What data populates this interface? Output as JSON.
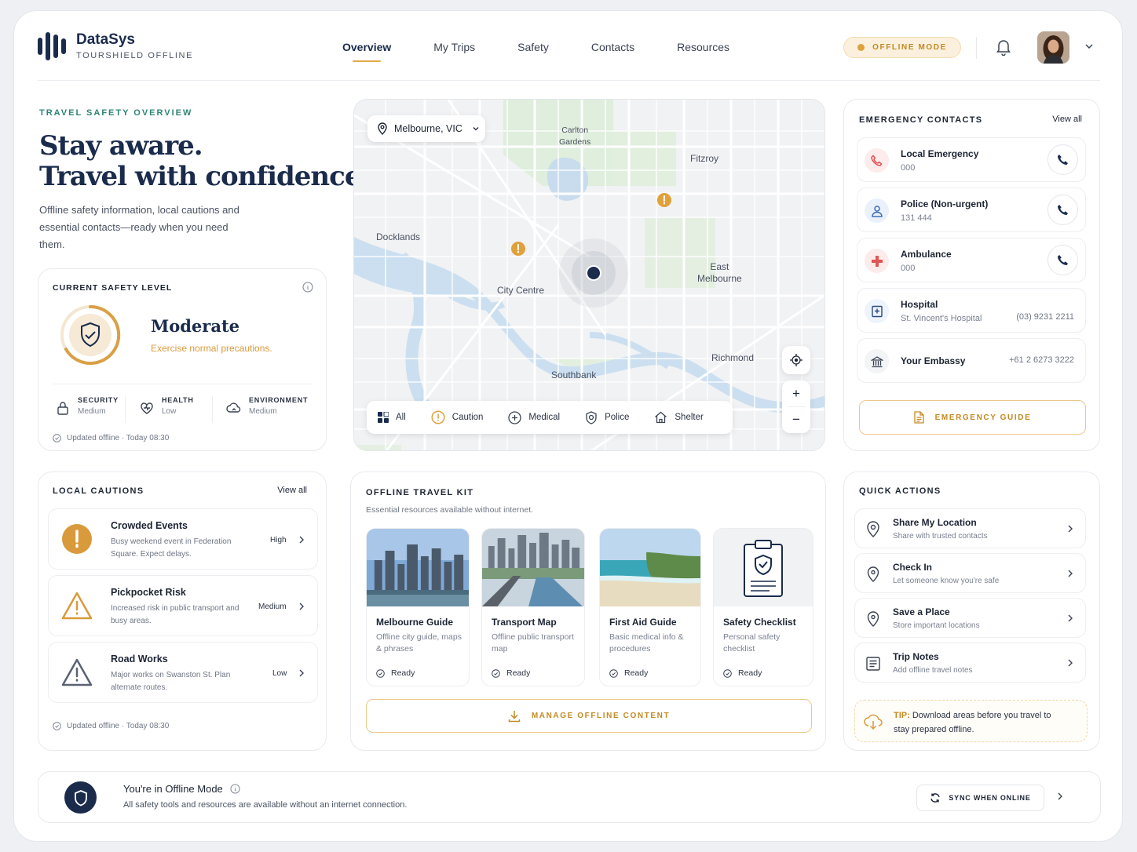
{
  "brand": {
    "name": "DataSys",
    "subtitle": "TOURSHIELD OFFLINE"
  },
  "nav": {
    "items": [
      "Overview",
      "My Trips",
      "Safety",
      "Contacts",
      "Resources"
    ],
    "active": "Overview"
  },
  "header": {
    "offline_mode_label": "OFFLINE MODE"
  },
  "hero": {
    "kicker": "TRAVEL SAFETY OVERVIEW",
    "title_line1": "Stay aware.",
    "title_line2": "Travel with confidence.",
    "description": "Offline safety information, local cautions and essential contacts—ready when you need them."
  },
  "safety_level": {
    "label": "CURRENT SAFETY LEVEL",
    "level": "Moderate",
    "advice": "Exercise normal precautions.",
    "metrics": [
      {
        "label": "SECURITY",
        "value": "Medium",
        "icon": "lock-icon"
      },
      {
        "label": "HEALTH",
        "value": "Low",
        "icon": "heart-icon"
      },
      {
        "label": "ENVIRONMENT",
        "value": "Medium",
        "icon": "cloud-icon"
      }
    ],
    "updated": "Updated offline · Today 08:30"
  },
  "map": {
    "location": "Melbourne, VIC",
    "labels": {
      "carlton": "Carlton\nGardens",
      "fitzroy": "Fitzroy",
      "docklands": "Docklands",
      "east_melbourne": "East\nMelbourne",
      "city_centre": "City Centre",
      "richmond": "Richmond",
      "southbank": "Southbank"
    },
    "filters": [
      "All",
      "Caution",
      "Medical",
      "Police",
      "Shelter"
    ],
    "zoom_in": "+",
    "zoom_out": "−"
  },
  "emergency": {
    "title": "EMERGENCY CONTACTS",
    "view_all": "View all",
    "contacts": [
      {
        "name": "Local Emergency",
        "number": "000",
        "icon": "phone-icon"
      },
      {
        "name": "Police (Non-urgent)",
        "number": "131 444",
        "icon": "person-icon"
      },
      {
        "name": "Ambulance",
        "number": "000",
        "icon": "medical-cross-icon"
      },
      {
        "name": "Hospital",
        "number": "St. Vincent's Hospital",
        "phone": "(03) 9231 2211",
        "icon": "hospital-icon"
      },
      {
        "name": "Your Embassy",
        "phone": "+61 2 6273 3222",
        "icon": "embassy-icon"
      }
    ],
    "guide_button": "EMERGENCY GUIDE"
  },
  "cautions": {
    "title": "LOCAL CAUTIONS",
    "view_all": "View all",
    "items": [
      {
        "title": "Crowded Events",
        "desc": "Busy weekend event in Federation Square. Expect delays.",
        "severity": "High"
      },
      {
        "title": "Pickpocket Risk",
        "desc": "Increased risk in public transport and busy areas.",
        "severity": "Medium"
      },
      {
        "title": "Road Works",
        "desc": "Major works on Swanston St. Plan alternate routes.",
        "severity": "Low"
      }
    ],
    "updated": "Updated offline · Today 08:30"
  },
  "kit": {
    "title": "OFFLINE TRAVEL KIT",
    "subtitle": "Essential resources available without internet.",
    "items": [
      {
        "title": "Melbourne Guide",
        "desc": "Offline city guide, maps & phrases",
        "status": "Ready"
      },
      {
        "title": "Transport Map",
        "desc": "Offline public transport map",
        "status": "Ready"
      },
      {
        "title": "First Aid Guide",
        "desc": "Basic medical info & procedures",
        "status": "Ready"
      },
      {
        "title": "Safety Checklist",
        "desc": "Personal safety checklist",
        "status": "Ready"
      }
    ],
    "manage_button": "MANAGE OFFLINE CONTENT"
  },
  "quick_actions": {
    "title": "QUICK ACTIONS",
    "items": [
      {
        "title": "Share My Location",
        "desc": "Share with trusted contacts"
      },
      {
        "title": "Check In",
        "desc": "Let someone know you're safe"
      },
      {
        "title": "Save a Place",
        "desc": "Store important locations"
      },
      {
        "title": "Trip Notes",
        "desc": "Add offline travel notes"
      }
    ],
    "tip_label": "TIP:",
    "tip_text": " Download areas before you travel to stay prepared offline."
  },
  "offline_banner": {
    "title": "You're in Offline Mode",
    "desc": "All safety tools and resources are available without an internet connection.",
    "sync_button": "SYNC WHEN ONLINE"
  },
  "colors": {
    "navy": "#1a2b4c",
    "accent": "#e0a94a",
    "teal": "#2d8476",
    "danger": "#e25555"
  }
}
